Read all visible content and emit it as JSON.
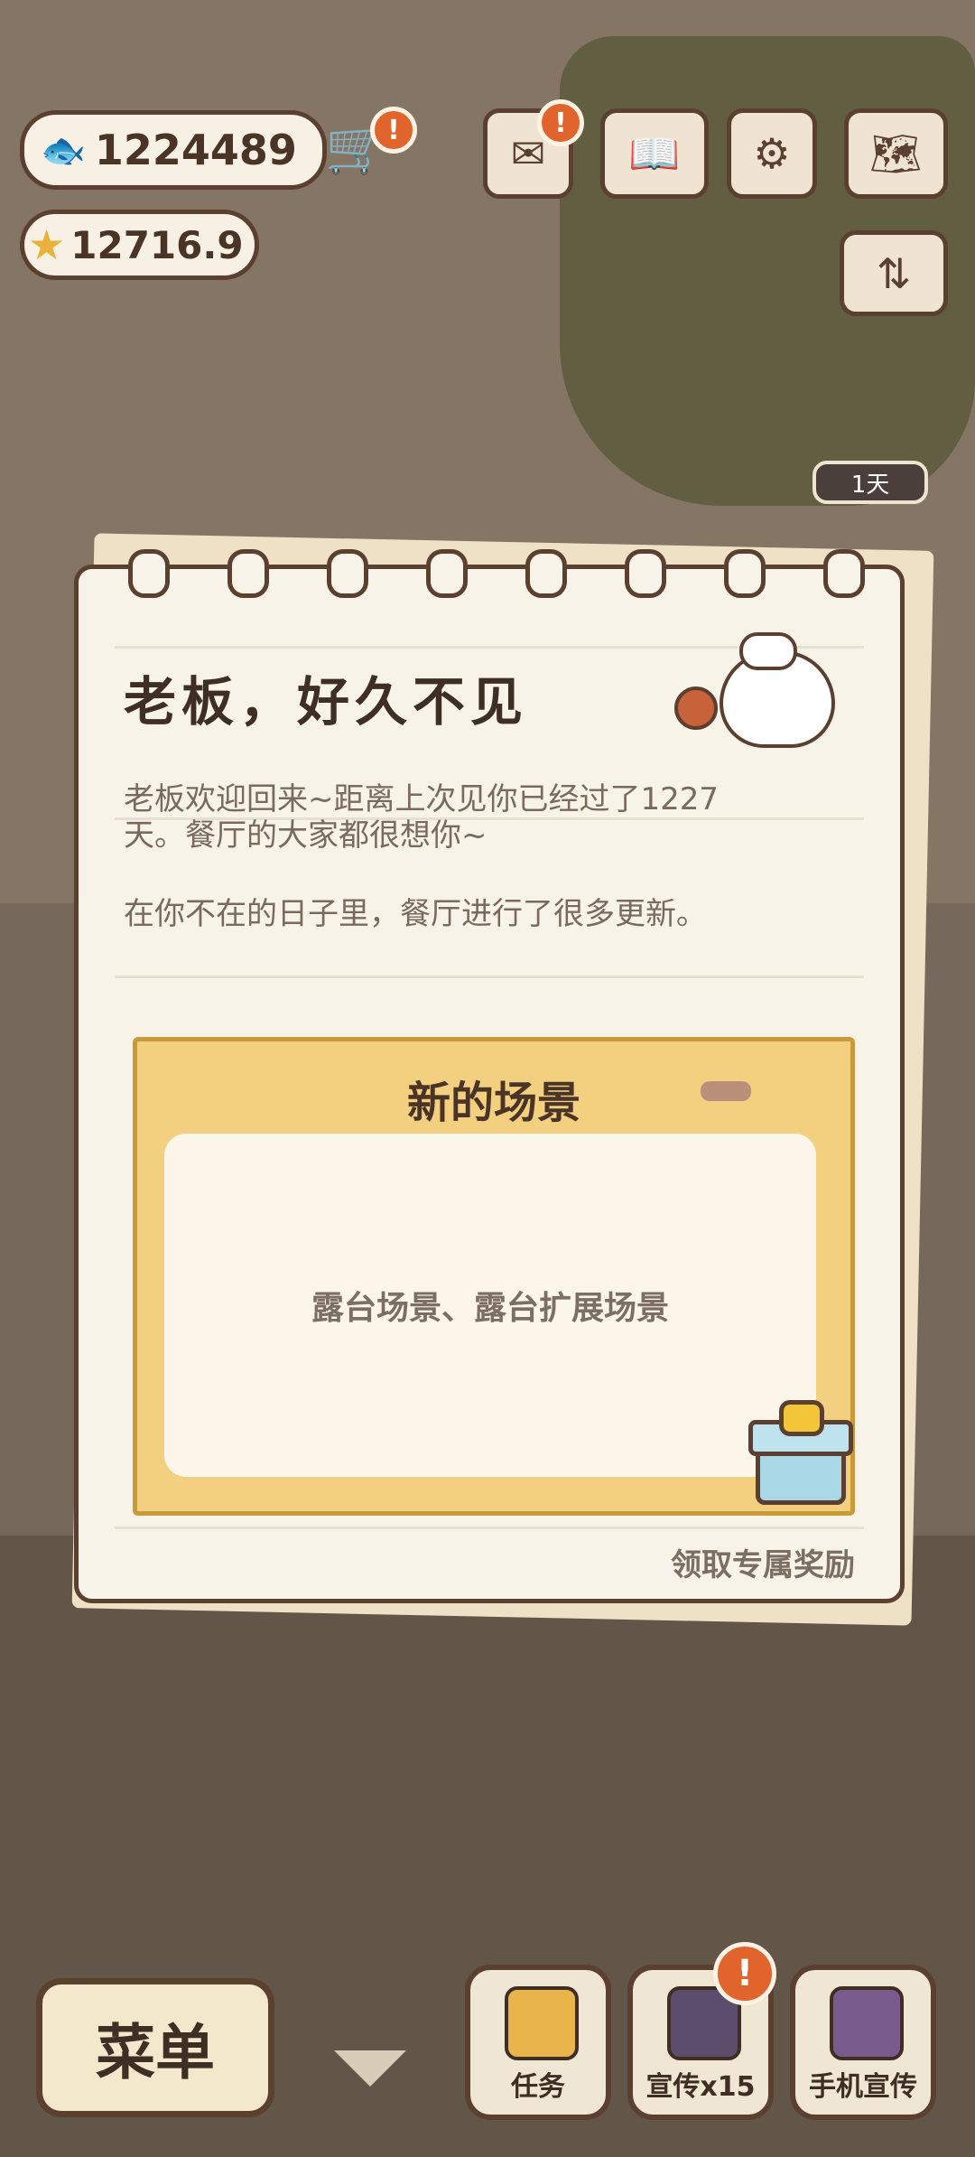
{
  "hud": {
    "fish_count": "1224489",
    "star_count": "12716.9",
    "badge_mark": "!",
    "day_label": "1天"
  },
  "dialog": {
    "title": "老板，好久不见",
    "message_line1": "老板欢迎回来~距离上次见你已经过了1227",
    "message_line2": "天。餐厅的大家都很想你~",
    "message_line3": "在你不在的日子里，餐厅进行了很多更新。",
    "card_title": "新的场景",
    "card_body": "露台场景、露台扩展场景",
    "reward_label": "领取专属奖励"
  },
  "bottom_bar": {
    "menu_label": "菜单",
    "task_label": "任务",
    "promote_label": "宣传x15",
    "phone_promote_label": "手机宣传"
  },
  "colors": {
    "accent_orange": "#e0642b",
    "outline_brown": "#5b3f2f",
    "card_yellow": "#f3cf80"
  },
  "icons": [
    "fish-icon",
    "cart-icon",
    "star-icon",
    "mail-icon",
    "book-icon",
    "gear-icon",
    "map-icon",
    "sort-icon",
    "gift-icon",
    "check-icon",
    "promo-icon",
    "phone-icon"
  ]
}
